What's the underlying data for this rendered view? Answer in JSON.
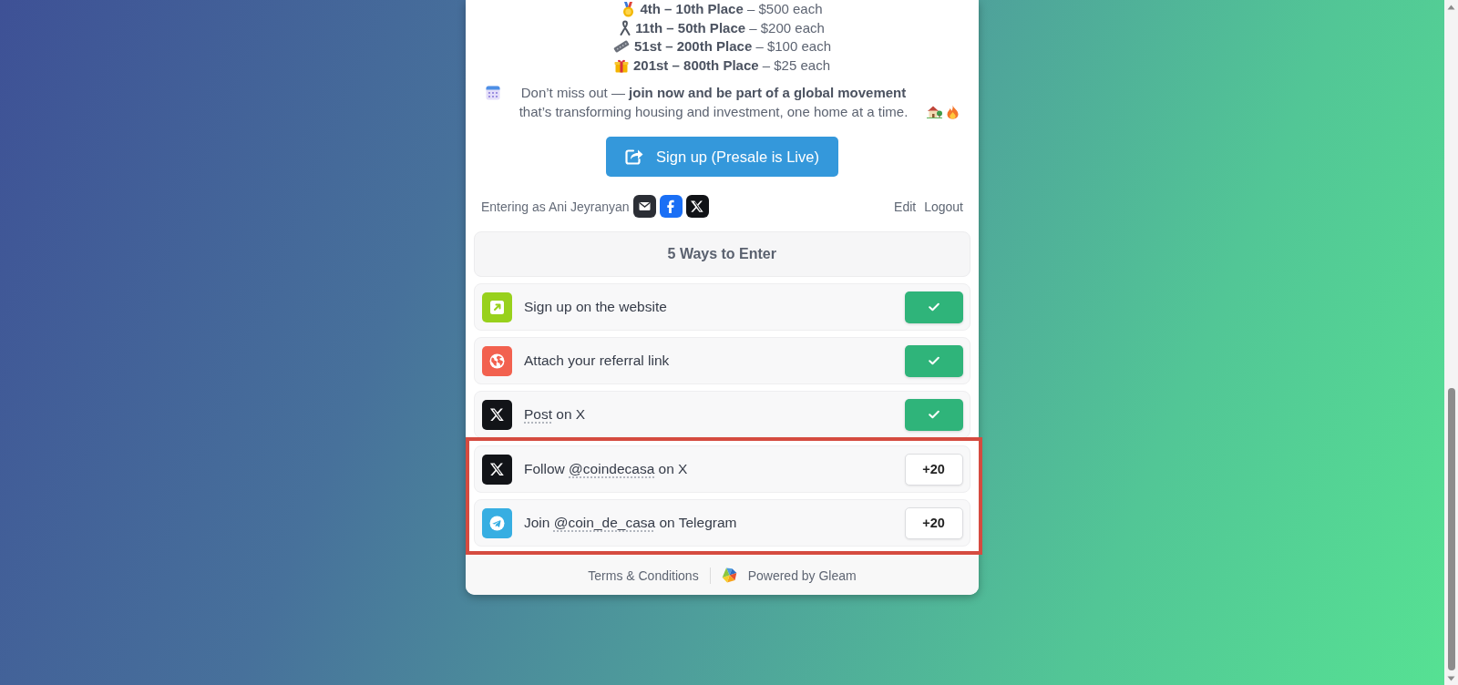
{
  "prizes": [
    "**4th – 10th Place** – $500 each",
    "**11th – 50th Place** – $200 each",
    "**51st – 200th Place** – $100 each",
    "**201st – 800th Place** – $25 each"
  ],
  "promo": "Don’t miss out — **join now and be part of a global movement** that’s transforming housing and investment, one home at a time.",
  "signup_button": {
    "label": "Sign up (Presale is Live)"
  },
  "entrant": {
    "text": "Entering as Ani Jeyranyan",
    "links": [
      "Edit",
      "Logout"
    ]
  },
  "entries_header": "5 Ways to Enter",
  "entries": [
    {
      "kind": "visit",
      "color": "#98d11c",
      "text": "Sign up on the website",
      "completed": true,
      "highlighted": false
    },
    {
      "kind": "referral",
      "color": "#f2614f",
      "text": "Attach your referral link",
      "completed": true,
      "highlighted": false
    },
    {
      "kind": "x",
      "color": "#121418",
      "link": "Post",
      "after": "on X",
      "completed": true,
      "highlighted": false
    },
    {
      "kind": "x",
      "color": "#121418",
      "before": "Follow",
      "link": "@coindecasa",
      "after": "on X",
      "completed": false,
      "points": "+20",
      "highlighted": true
    },
    {
      "kind": "telegram",
      "color": "#37aee2",
      "before": "Join",
      "link": "@coin_de_casa",
      "after": "on Telegram",
      "completed": false,
      "points": "+20",
      "highlighted": true
    }
  ],
  "footer": {
    "terms": "Terms & Conditions",
    "powered_by": "Powered by Gleam"
  }
}
